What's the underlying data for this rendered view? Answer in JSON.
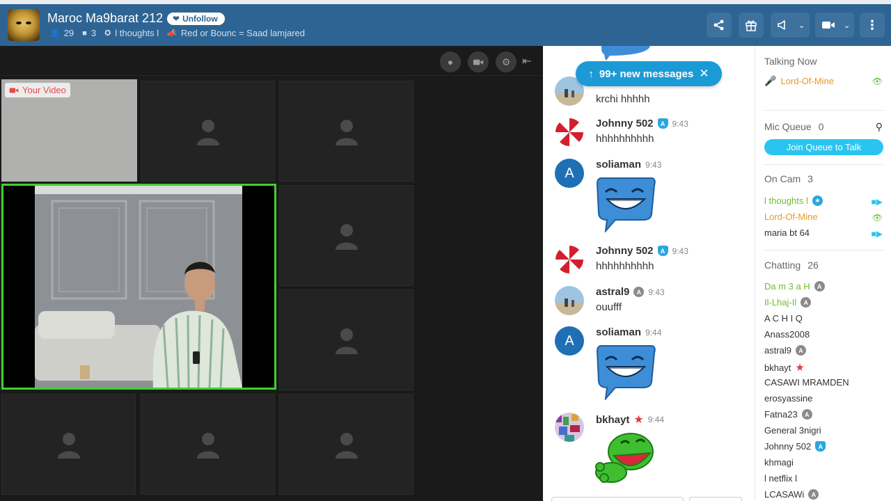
{
  "header": {
    "room_title": "Maroc Ma9barat 212",
    "unfollow_label": "Unfollow",
    "users_count": "29",
    "cams_count": "3",
    "owner": "l thoughts l",
    "announcement": "Red or Bounc = Saad lamjared",
    "bg_color": "#2e6493"
  },
  "video": {
    "your_video_label": "Your Video"
  },
  "chat": {
    "new_messages": "99+ new messages",
    "messages": [
      {
        "name": "",
        "time": "",
        "text": "krchi hhhhh",
        "avatar": "beach"
      },
      {
        "name": "Johnny 502",
        "badge": "shield",
        "time": "9:43",
        "text": "hhhhhhhhhh",
        "avatar": "umbrella"
      },
      {
        "name": "soliaman",
        "time": "9:43",
        "text": "",
        "avatar": "A",
        "sticker": "laughing-bubble"
      },
      {
        "name": "Johnny 502",
        "badge": "shield",
        "time": "9:43",
        "text": "hhhhhhhhhh",
        "avatar": "umbrella"
      },
      {
        "name": "astral9",
        "badge": "A",
        "time": "9:43",
        "text": "ouufff",
        "avatar": "beach"
      },
      {
        "name": "soliaman",
        "time": "9:44",
        "text": "",
        "avatar": "A",
        "sticker": "laughing-bubble"
      },
      {
        "name": "bkhayt",
        "badge": "star",
        "time": "9:44",
        "text": "",
        "avatar": "pattern",
        "sticker": "laughing-frog"
      }
    ]
  },
  "sidebar": {
    "talking_now_title": "Talking Now",
    "talking_now_user": "Lord-Of-Mine",
    "mic_queue_title": "Mic Queue",
    "mic_queue_count": "0",
    "join_queue_label": "Join Queue to Talk",
    "on_cam_title": "On Cam",
    "on_cam_count": "3",
    "on_cam_users": [
      "l thoughts l",
      "Lord-Of-Mine",
      "maria bt 64"
    ],
    "chatting_title": "Chatting",
    "chatting_count": "26",
    "chatting_users": [
      "Da m 3 a H",
      "Il-Lhaj-Il",
      "A C H I Q",
      "Anass2008",
      "astral9",
      "bkhayt",
      "CASAWI MRAMDEN",
      "erosyassine",
      "Fatna23",
      "General 3nigri",
      "Johnny 502",
      "khmagi",
      "l netflix l",
      "LCASAWi"
    ]
  }
}
